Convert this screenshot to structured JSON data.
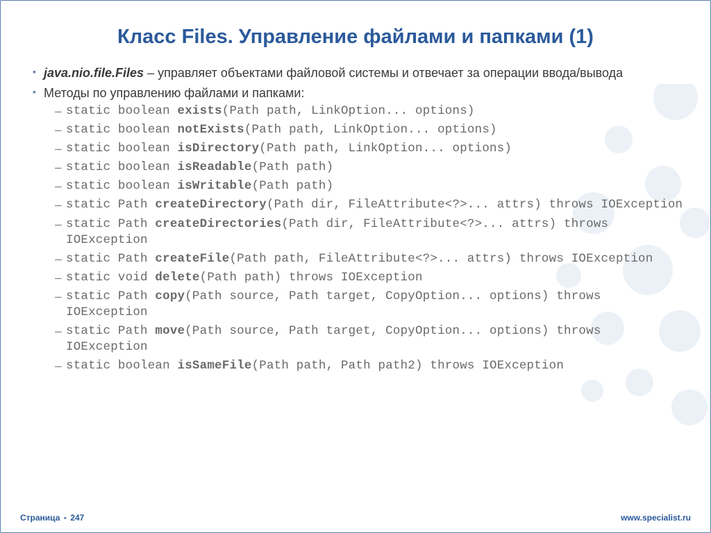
{
  "title": "Класс Files. Управление файлами и папками (1)",
  "bullets": {
    "b1_bold": "java.nio.file.Files",
    "b1_rest": " – управляет объектами файловой системы и отвечает за операции ввода/вывода",
    "b2": "Методы по управлению файлами и папками:"
  },
  "methods": [
    {
      "pre": "static boolean ",
      "name": "exists",
      "post": "(Path path, LinkOption... options)"
    },
    {
      "pre": "static boolean ",
      "name": "notExists",
      "post": "(Path path, LinkOption... options)"
    },
    {
      "pre": "static boolean ",
      "name": "isDirectory",
      "post": "(Path path, LinkOption... options)"
    },
    {
      "pre": "static boolean ",
      "name": "isReadable",
      "post": "(Path path)"
    },
    {
      "pre": "static boolean ",
      "name": "isWritable",
      "post": "(Path path)"
    },
    {
      "pre": "static Path ",
      "name": "createDirectory",
      "post": "(Path dir, FileAttribute<?>... attrs) throws IOException"
    },
    {
      "pre": "static Path ",
      "name": "createDirectories",
      "post": "(Path dir, FileAttribute<?>... attrs) throws IOException"
    },
    {
      "pre": "static Path ",
      "name": "createFile",
      "post": "(Path path, FileAttribute<?>... attrs) throws IOException"
    },
    {
      "pre": "static void ",
      "name": "delete",
      "post": "(Path path) throws IOException"
    },
    {
      "pre": "static Path ",
      "name": "copy",
      "post": "(Path source, Path target, CopyOption... options) throws IOException"
    },
    {
      "pre": "static Path ",
      "name": "move",
      "post": "(Path source, Path target, CopyOption... options) throws IOException"
    },
    {
      "pre": "static boolean ",
      "name": "isSameFile",
      "post": "(Path path, Path path2) throws IOException"
    }
  ],
  "footer": {
    "page_label": "Страница",
    "page_num": "247",
    "url": "www.specialist.ru"
  }
}
